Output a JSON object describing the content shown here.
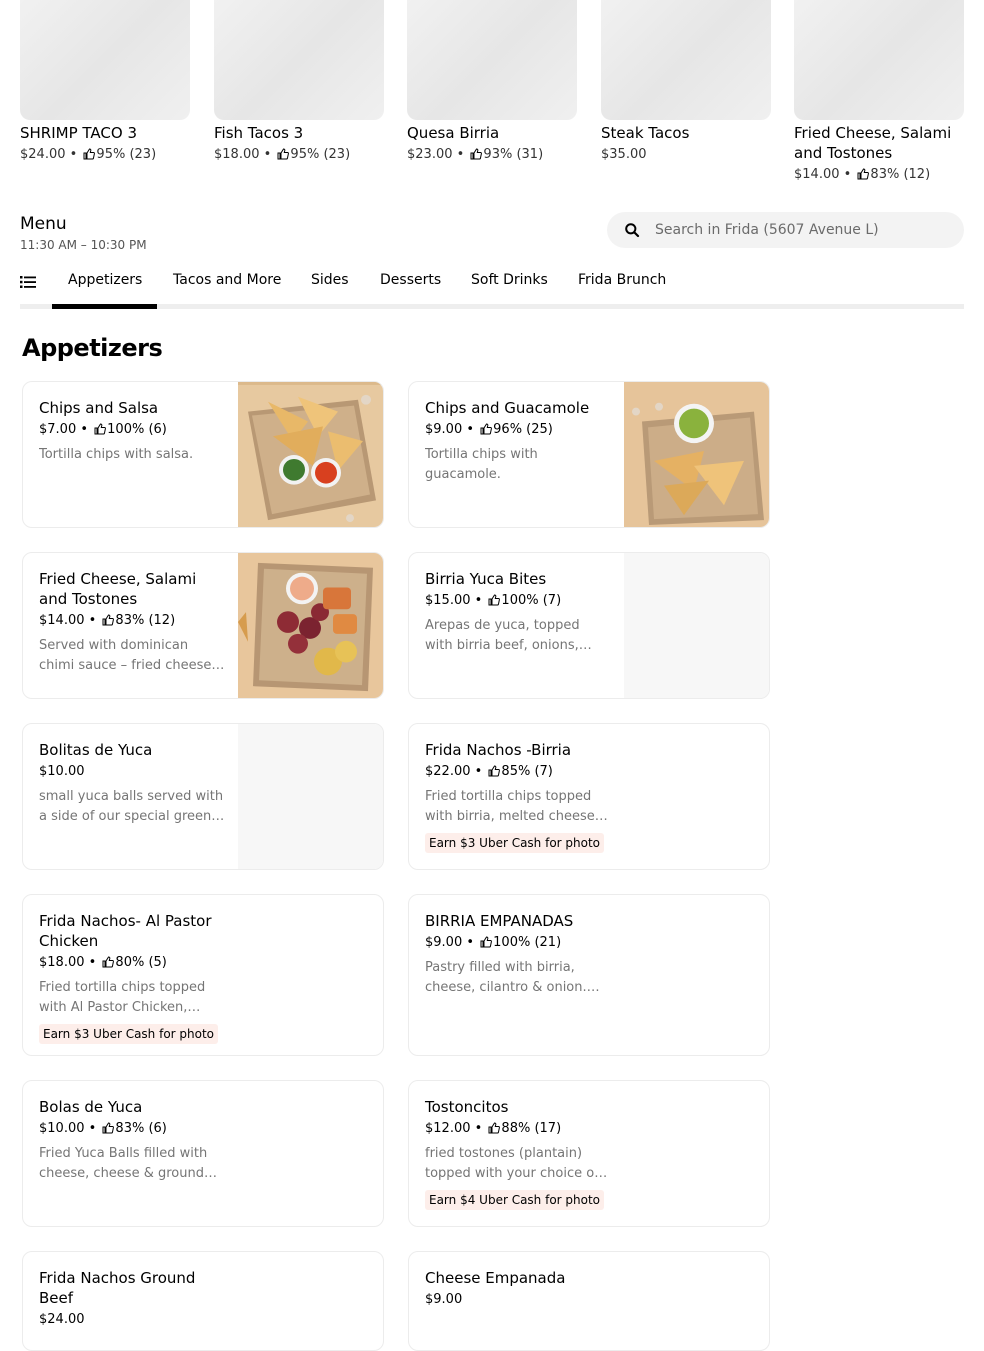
{
  "featured": [
    {
      "name": "SHRIMP TACO 3",
      "meta": "$24.00 • ",
      "rating": "95% (23)"
    },
    {
      "name": "Fish Tacos 3",
      "meta": "$18.00 • ",
      "rating": "95% (23)"
    },
    {
      "name": "Quesa Birria",
      "meta": "$23.00 • ",
      "rating": "93% (31)"
    },
    {
      "name": "Steak Tacos",
      "meta": "$35.00",
      "rating": ""
    },
    {
      "name": "Fried Cheese, Salami and Tostones",
      "meta": "$14.00 • ",
      "rating": "83% (12)"
    }
  ],
  "menu": {
    "title": "Menu",
    "hours": "11:30 AM – 10:30 PM"
  },
  "search": {
    "placeholder": "Search in Frida (5607 Avenue L)",
    "icon": "search-icon"
  },
  "tabs": [
    "Appetizers",
    "Tacos and More",
    "Sides",
    "Desserts",
    "Soft Drinks",
    "Frida Brunch"
  ],
  "active_tab": "Appetizers",
  "section": {
    "title": "Appetizers"
  },
  "items": [
    {
      "name": "Chips and Salsa",
      "price": "$7.00 • ",
      "rating": "100% (6)",
      "desc": "Tortilla chips with salsa.",
      "promo": "",
      "image": "chips-salsa"
    },
    {
      "name": "Chips and Guacamole",
      "price": "$9.00 • ",
      "rating": "96% (25)",
      "desc": "Tortilla chips with guacamole.",
      "promo": "",
      "image": "chips-guac"
    },
    {
      "name": "Fried Cheese, Salami and Tostones",
      "price": "$14.00 • ",
      "rating": "83% (12)",
      "desc": "Served with dominican chimi sauce – fried cheese, salami and tostones.",
      "promo": "",
      "image": "fried-cheese"
    },
    {
      "name": "Birria Yuca Bites",
      "price": "$15.00 • ",
      "rating": "100% (7)",
      "desc": "Arepas de yuca, topped with birria beef, onions, cilantro, cheese.",
      "promo": "",
      "image": "placeholder"
    },
    {
      "name": "Bolitas de Yuca",
      "price": "$10.00",
      "rating": "",
      "desc": "small yuca balls served with a side of our special green sauce.",
      "promo": "",
      "image": "placeholder"
    },
    {
      "name": "Frida Nachos -Birria",
      "price": "$22.00 • ",
      "rating": "85% (7)",
      "desc": "Fried tortilla chips topped with birria, melted cheese, beans and sour cream.",
      "promo": "Earn $3 Uber Cash for photo",
      "image": ""
    },
    {
      "name": "Frida Nachos- Al Pastor Chicken",
      "price": "$18.00 • ",
      "rating": "80% (5)",
      "desc": "Fried tortilla chips topped with Al Pastor Chicken, melted cheese.",
      "promo": "Earn $3 Uber Cash for photo",
      "image": ""
    },
    {
      "name": "BIRRIA EMPANADAS",
      "price": "$9.00 • ",
      "rating": "100% (21)",
      "desc": "Pastry filled with birria, cheese, cilantro & onion. Served with consome.",
      "promo": "",
      "image": ""
    },
    {
      "name": "Bolas de Yuca",
      "price": "$10.00 • ",
      "rating": "83% (6)",
      "desc": "Fried Yuca Balls filled with cheese, cheese & ground beef.",
      "promo": "",
      "image": ""
    },
    {
      "name": "Tostoncitos",
      "price": "$12.00 • ",
      "rating": "88% (17)",
      "desc": "fried tostones (plantain) topped with your choice of protein.",
      "promo": "Earn $4 Uber Cash for photo",
      "image": ""
    },
    {
      "name": "Frida Nachos Ground Beef",
      "price": "$24.00",
      "rating": "",
      "desc": "",
      "promo": "",
      "image": ""
    },
    {
      "name": "Cheese Empanada",
      "price": "$9.00",
      "rating": "",
      "desc": "",
      "promo": "",
      "image": ""
    }
  ]
}
